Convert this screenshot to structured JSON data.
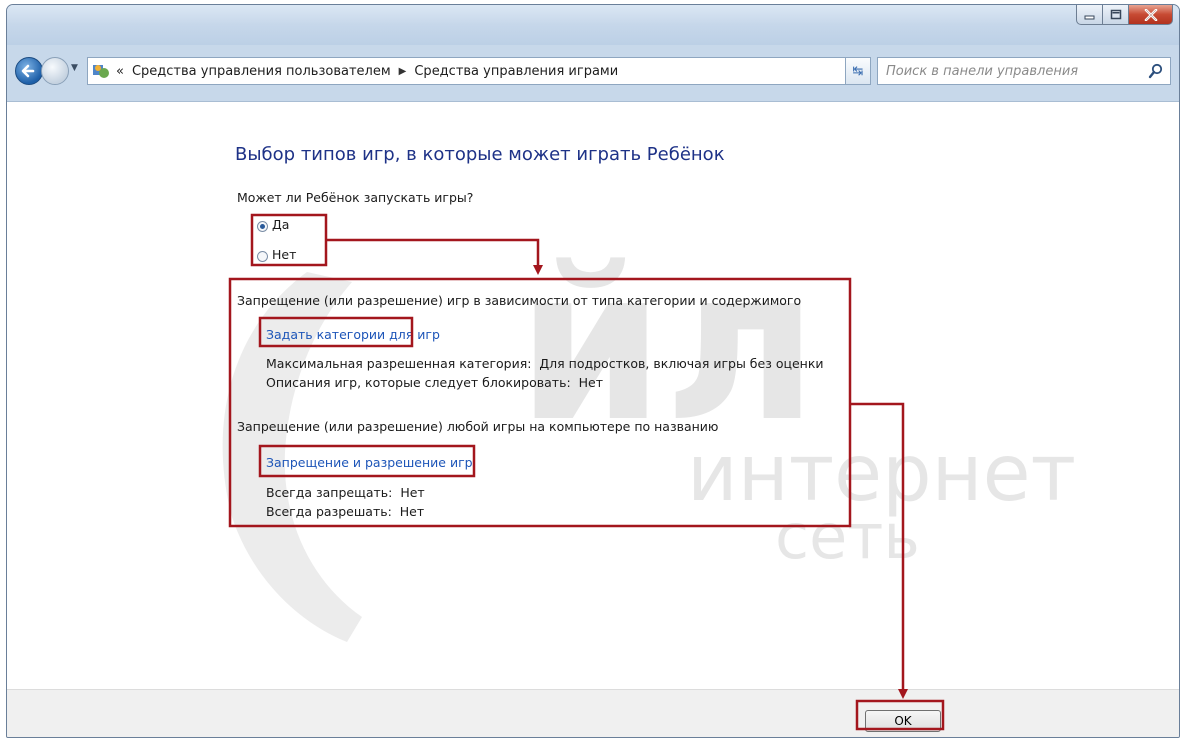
{
  "window": {
    "controls": {
      "minimize_icon": "minimize-icon",
      "maximize_icon": "maximize-icon",
      "close_icon": "close-icon"
    }
  },
  "address": {
    "prefix": "«",
    "crumbs": [
      "Средства управления пользователем",
      "Средства управления играми"
    ],
    "search_placeholder": "Поиск в панели управления"
  },
  "watermark": {
    "big": "йл",
    "mid": "интернет",
    "small": "сеть"
  },
  "page": {
    "title": "Выбор типов игр, в которые может играть Ребёнок",
    "question": "Может ли Ребёнок запускать игры?",
    "radio_yes": "Да",
    "radio_no": "Нет",
    "selected": "Да",
    "section1_title": "Запрещение (или разрешение) игр в зависимости от типа категории и содержимого",
    "section1_link": "Задать категории для игр",
    "max_rating_label": "Максимальная разрешенная категория:",
    "max_rating_value": "Для подростков, включая игры без оценки",
    "block_desc_label": "Описания игр, которые следует блокировать:",
    "block_desc_value": "Нет",
    "section2_title": "Запрещение (или разрешение) любой игры на компьютере по названию",
    "section2_link": "Запрещение и разрешение игр",
    "always_block_label": "Всегда запрещать:",
    "always_block_value": "Нет",
    "always_allow_label": "Всегда разрешать:",
    "always_allow_value": "Нет"
  },
  "footer": {
    "ok_label": "OK"
  },
  "colors": {
    "annotation": "#a3161d",
    "title_blue": "#1e3287",
    "link_blue": "#1d55b8"
  }
}
